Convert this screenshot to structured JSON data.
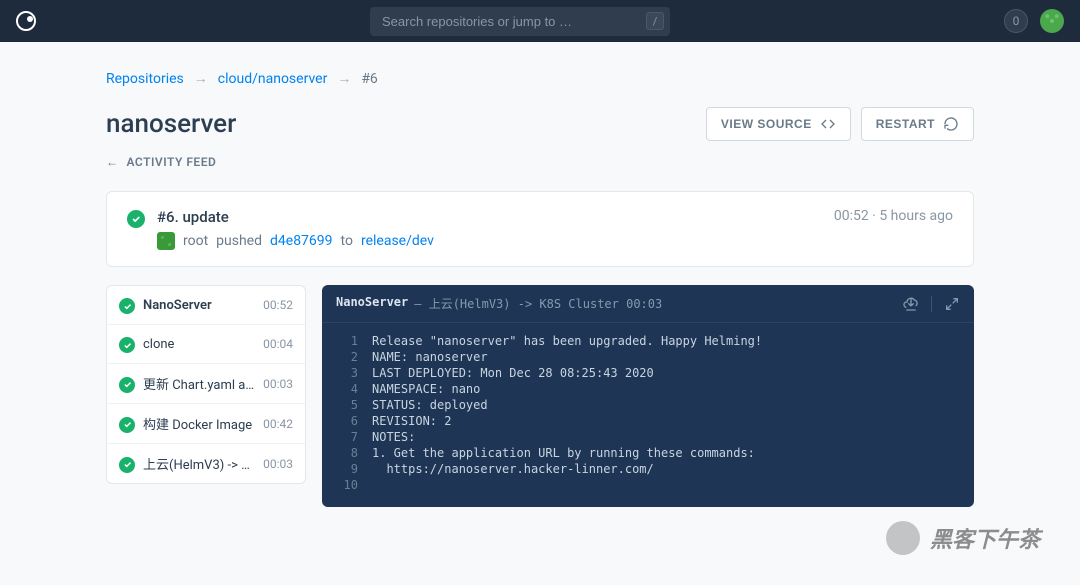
{
  "topbar": {
    "search_placeholder": "Search repositories or jump to …",
    "search_key": "/",
    "badge_count": "0"
  },
  "breadcrumb": {
    "root": "Repositories",
    "repo": "cloud/nanoserver",
    "current": "#6"
  },
  "header": {
    "title": "nanoserver",
    "view_source": "VIEW SOURCE",
    "restart": "RESTART"
  },
  "activity_feed_label": "ACTIVITY FEED",
  "event": {
    "title": "#6. update",
    "actor": "root",
    "verb": "pushed",
    "commit": "d4e87699",
    "to": "to",
    "branch": "release/dev",
    "duration": "00:52",
    "time_ago": "5 hours ago"
  },
  "steps": [
    {
      "name": "NanoServer",
      "time": "00:52",
      "header": true
    },
    {
      "name": "clone",
      "time": "00:04"
    },
    {
      "name": "更新 Chart.yaml appVer…",
      "time": "00:03"
    },
    {
      "name": "构建 Docker Image",
      "time": "00:42"
    },
    {
      "name": "上云(HelmV3) -> K8S …",
      "time": "00:03"
    }
  ],
  "log": {
    "title_strong": "NanoServer",
    "title_rest": "— 上云(HelmV3) -> K8S Cluster 00:03",
    "lines": [
      "Release \"nanoserver\" has been upgraded. Happy Helming!",
      "NAME: nanoserver",
      "LAST DEPLOYED: Mon Dec 28 08:25:43 2020",
      "NAMESPACE: nano",
      "STATUS: deployed",
      "REVISION: 2",
      "NOTES:",
      "1. Get the application URL by running these commands:",
      "  https://nanoserver.hacker-linner.com/",
      ""
    ]
  },
  "watermark": "黑客下午茶"
}
